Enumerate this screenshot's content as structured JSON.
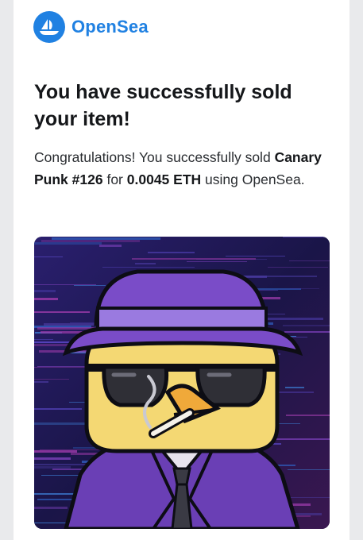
{
  "brand": {
    "name": "OpenSea",
    "color": "#2081e2"
  },
  "email": {
    "headline": "You have successfully sold your item!",
    "intro": "Congratulations! You successfully sold",
    "item_name": "Canary Punk #126",
    "word_for": "for",
    "price": "0.0045 ETH",
    "word_using": "using",
    "platform": "OpenSea."
  },
  "nft_image": {
    "subject": "cartoon bird in purple hat, suit and sunglasses smoking"
  }
}
